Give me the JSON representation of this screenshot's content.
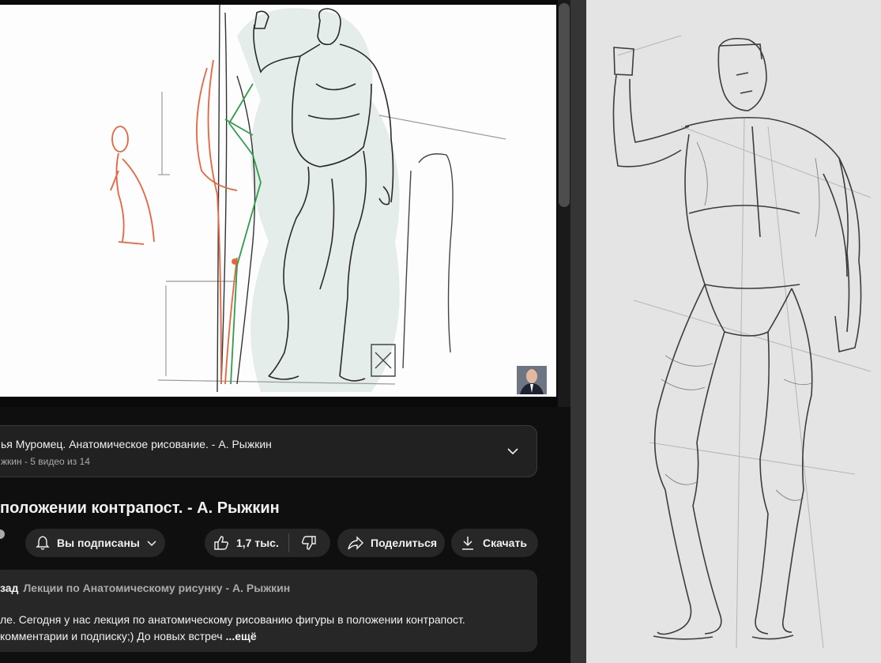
{
  "playlist": {
    "title": "ья Муромец. Анатомическое рисование. - А. Рыжкин",
    "meta": "жкин - 5 видео из 14"
  },
  "video": {
    "title": "положении контрапост. - А. Рыжкин"
  },
  "actions": {
    "subscribe_label": "Вы подписаны",
    "like_count": "1,7 тыс.",
    "share_label": "Поделиться",
    "download_label": "Скачать"
  },
  "description": {
    "tag_back": "зад",
    "tag_playlist": "Лекции по Анатомическому рисунку - А. Рыжкин",
    "line1": "ле. Сегодня у нас лекция по анатомическому рисованию фигуры в положении контрапост.",
    "line2": "комментарии и подписку;) До новых встреч",
    "more": "...ещё"
  },
  "icons": {
    "bell": "bell-icon",
    "chevron": "chevron-down-icon",
    "like": "thumbs-up-icon",
    "dislike": "thumbs-down-icon",
    "share": "share-arrow-icon",
    "download": "download-icon",
    "verified": "verified-check-icon"
  },
  "colors": {
    "page_bg": "#0f0f0f",
    "button_bg": "#272727",
    "secondary_text": "#aaaaaa",
    "sketch_orange": "#e8643c",
    "sketch_green": "#2e9e48",
    "canvas_bg": "#e4e4e4"
  }
}
